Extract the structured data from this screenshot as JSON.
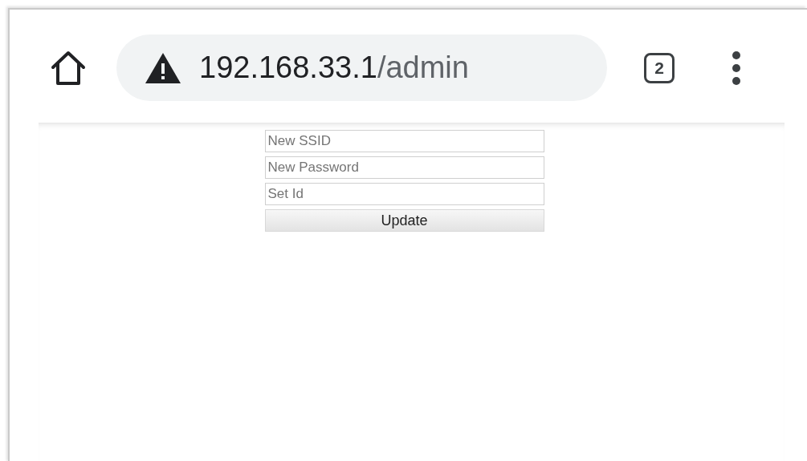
{
  "toolbar": {
    "address": {
      "host": "192.168.33.1",
      "path": "/admin"
    },
    "tab_count": "2"
  },
  "form": {
    "fields": [
      {
        "placeholder": "New SSID"
      },
      {
        "placeholder": "New Password"
      },
      {
        "placeholder": "Set Id"
      }
    ],
    "button": "Update"
  }
}
